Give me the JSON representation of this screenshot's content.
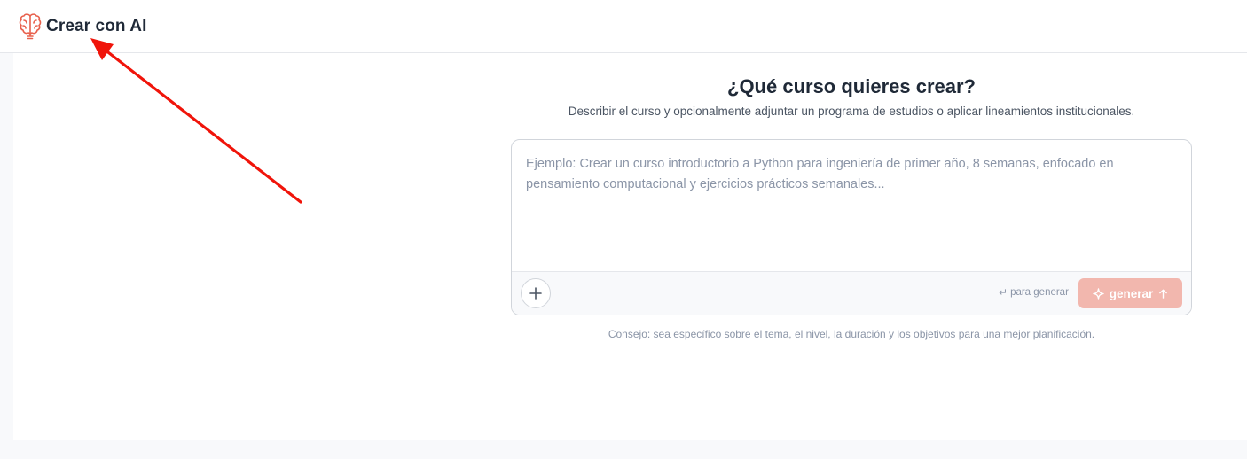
{
  "header": {
    "title": "Crear con AI",
    "icon": "brain-icon",
    "accent_color": "#e8604c"
  },
  "main": {
    "heading": "¿Qué curso quieres crear?",
    "subheading": "Describir el curso y opcionalmente adjuntar un programa de estudios o aplicar lineamientos institucionales.",
    "prompt": {
      "value": "",
      "placeholder": "Ejemplo: Crear un curso introductorio a Python para ingeniería de primer año, 8 semanas, enfocado en pensamiento computacional y ejercicios prácticos semanales..."
    },
    "footer": {
      "attach_icon": "plus-icon",
      "hint_icon": "enter-icon",
      "hint": "para generar",
      "generate_label": "generar",
      "generate_color": "#f2b7ae"
    },
    "tip": "Consejo: sea específico sobre el tema, el nivel, la duración y los objetivos para una mejor planificación."
  },
  "annotation": {
    "color": "#f0140a"
  }
}
